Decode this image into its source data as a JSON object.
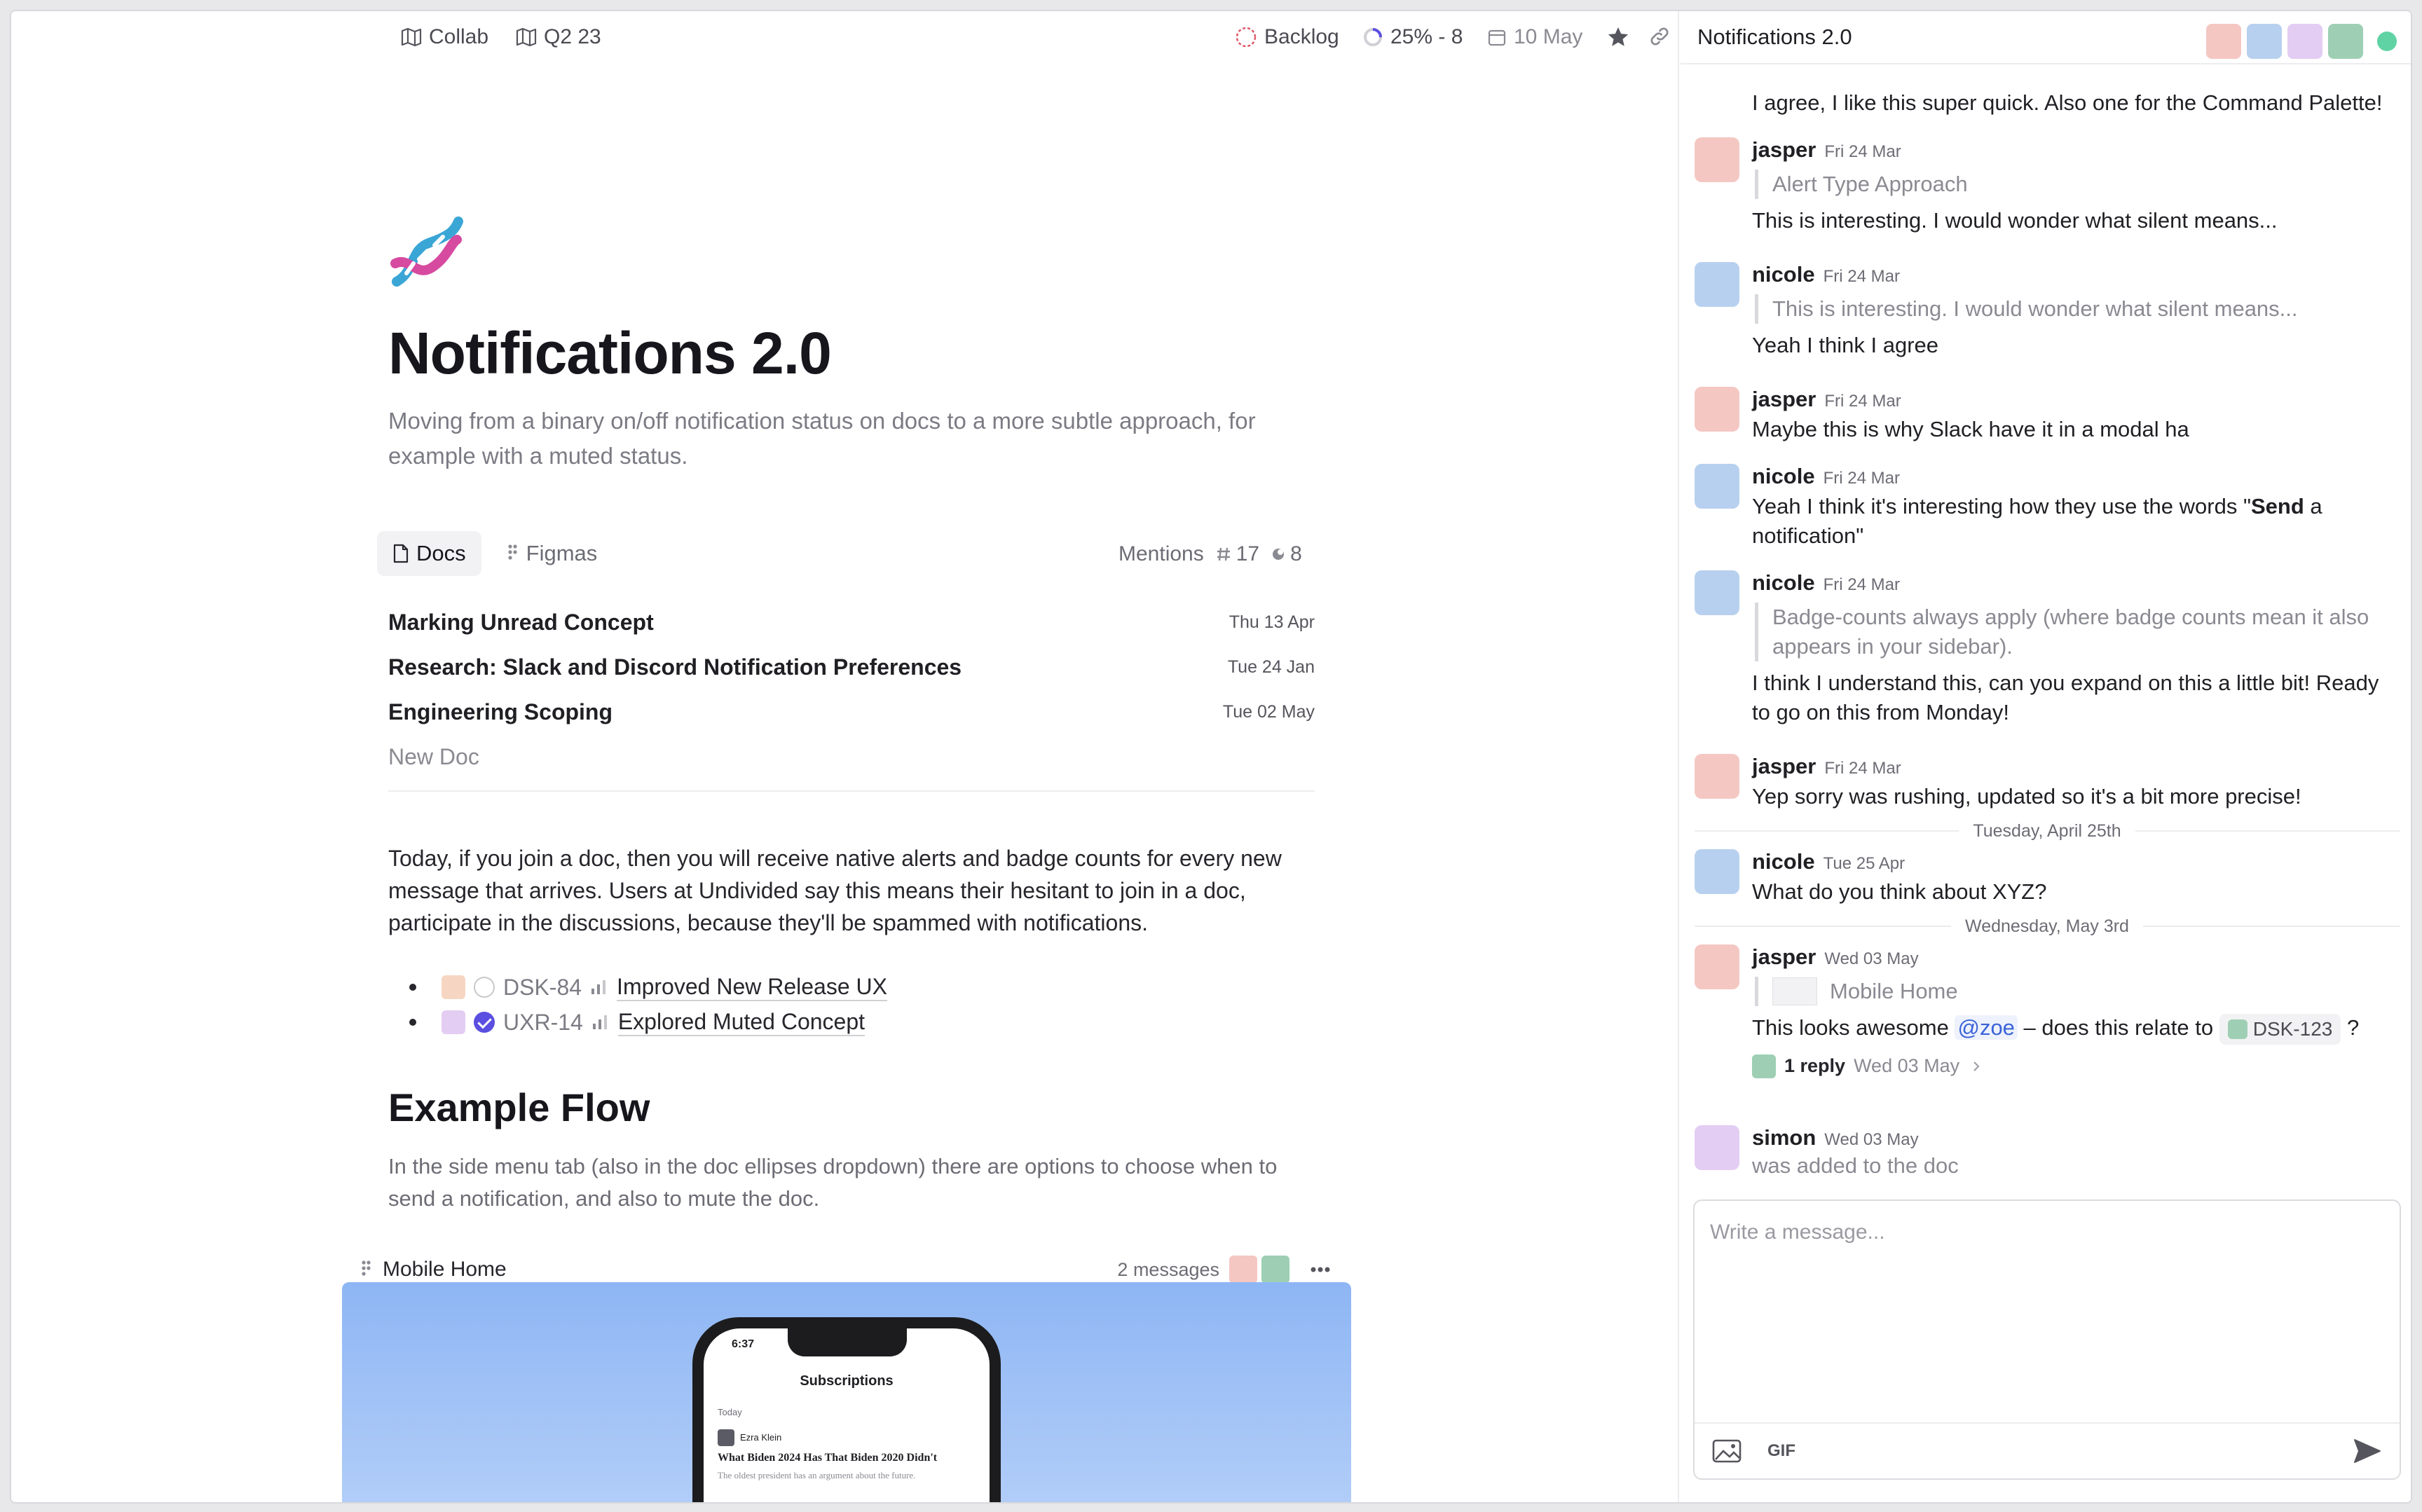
{
  "topbar": {
    "breadcrumb_1": "Collab",
    "breadcrumb_2": "Q2 23",
    "status": "Backlog",
    "progress": "25% - 8",
    "progress_fraction": 0.25,
    "due_date": "10 May"
  },
  "doc": {
    "title": "Notifications 2.0",
    "subtitle": "Moving from a binary on/off notification status on docs to a more subtle approach, for example with a muted status.",
    "tabs": [
      {
        "label": "Docs"
      },
      {
        "label": "Figmas"
      }
    ],
    "mentions_label": "Mentions",
    "mentions_figma_count": "17",
    "mentions_doc_count": "8",
    "docs": [
      {
        "name": "Marking Unread Concept",
        "date": "Thu 13 Apr"
      },
      {
        "name": "Research: Slack and Discord Notification Preferences",
        "date": "Tue 24 Jan"
      },
      {
        "name": "Engineering Scoping",
        "date": "Tue 02 May"
      }
    ],
    "new_doc": "New Doc",
    "paragraph": "Today, if you join a doc, then you will receive native alerts and badge counts for every new message that arrives.  Users at Undivided say this means their hesitant to join in a doc, participate in the discussions, because they'll be spammed with notifications.",
    "issues": [
      {
        "id": "DSK-84",
        "title": "Improved New Release UX",
        "done": false
      },
      {
        "id": "UXR-14",
        "title": "Explored Muted Concept",
        "done": true
      }
    ],
    "heading": "Example Flow",
    "paragraph2": "In the side menu tab (also in the doc ellipses dropdown) there are options to choose when to send a notification, and also to mute the doc.",
    "figma": {
      "name": "Mobile Home",
      "messages": "2 messages",
      "phone_time": "6:37",
      "phone_title": "Subscriptions",
      "phone_section": "Today",
      "phone_author": "Ezra Klein",
      "phone_headline": "What Biden 2024 Has That Biden 2020 Didn't",
      "phone_sub": "The oldest president has an argument about the future."
    }
  },
  "chat": {
    "title": "Notifications 2.0",
    "partial_top": "I agree, I like this super quick. Also one for the Command Palette!",
    "messages": [
      {
        "author": "jasper",
        "date": "Fri 24 Mar",
        "quote": "Alert Type Approach",
        "text": "This is interesting. I would wonder what silent means..."
      },
      {
        "author": "nicole",
        "date": "Fri 24 Mar",
        "quote": "This is interesting. I would wonder what silent means...",
        "text": "Yeah I think I agree"
      },
      {
        "author": "jasper",
        "date": "Fri 24 Mar",
        "text": "Maybe this is why Slack have it in a modal ha"
      },
      {
        "author": "nicole",
        "date": "Fri 24 Mar",
        "text_a": "Yeah I think it's interesting how they use the words \"",
        "text_bold": "Send",
        "text_b": " a notification\""
      },
      {
        "author": "nicole",
        "date": "Fri 24 Mar",
        "quote": "Badge-counts always apply (where badge counts mean it also appears in your sidebar).",
        "text": "I think I understand this, can you expand on this a little bit! Ready to go on this from Monday!"
      },
      {
        "author": "jasper",
        "date": "Fri 24 Mar",
        "text": "Yep sorry was rushing, updated so it's a bit more precise!"
      },
      {
        "author": "nicole",
        "date": "Tue 25 Apr",
        "text": "What do you think about XYZ?"
      },
      {
        "author": "jasper",
        "date": "Wed 03 May",
        "quote": "Mobile Home",
        "text_a": "This looks awesome",
        "mention": "@zoe",
        "text_b": "– does this relate to",
        "chip": "DSK-123",
        "text_c": "?",
        "reply_count": "1 reply",
        "reply_date": "Wed 03 May"
      },
      {
        "author": "simon",
        "date": "Wed 03 May",
        "text": "was added to the doc"
      }
    ],
    "day_separators": [
      "Tuesday, April 25th",
      "Wednesday, May 3rd"
    ],
    "composer_placeholder": "Write a message...",
    "gif_label": "GIF"
  },
  "colors": {
    "accent": "#5a4fe0",
    "online": "#5fd3a4",
    "mention": "#3a63d8",
    "avatar_jasper": "#f4c7c3",
    "avatar_nicole": "#b8d0ef",
    "avatar_simon": "#e3cdf3",
    "avatar_zoe": "#9ecfb4"
  },
  "icons": [
    "map-icon",
    "status-dashed-circle-icon",
    "progress-ring-icon",
    "calendar-icon",
    "star-icon",
    "link-icon",
    "doc-icon",
    "figma-icon",
    "dna-emoji",
    "bar-chart-icon",
    "image-icon",
    "send-icon",
    "more-icon",
    "chevron-right-icon"
  ]
}
